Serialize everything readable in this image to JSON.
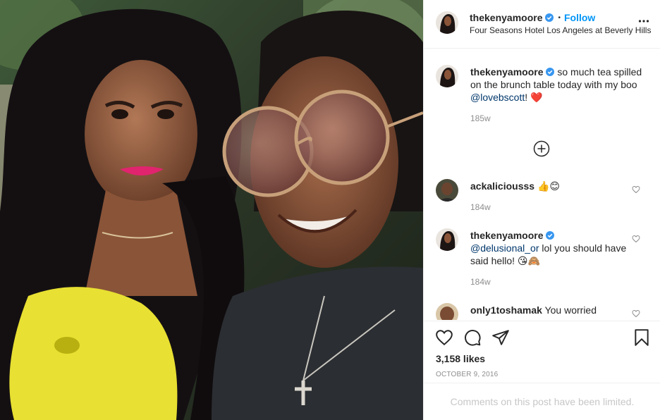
{
  "post": {
    "author": "thekenyamoore",
    "follow_label": "Follow",
    "separator": "•",
    "location": "Four Seasons Hotel Los Angeles at Beverly Hills",
    "likes": "3,158 likes",
    "date": "OCTOBER 9, 2016",
    "comments_limited": "Comments on this post have been limited."
  },
  "caption": {
    "author": "thekenyamoore",
    "text_before": "so much tea spilled on the brunch table today with my boo ",
    "mention": "@lovebscott",
    "text_after": "! ❤️",
    "age": "185w"
  },
  "comments": [
    {
      "author": "ackaliciousss",
      "text": "👍😊",
      "age": "184w"
    },
    {
      "author": "thekenyamoore",
      "mention": "@delusional_or",
      "text": " lol you should have said hello! 😘🙈",
      "age": "184w"
    },
    {
      "author": "only1toshamak",
      "text": "You worried"
    }
  ],
  "icons": {
    "more": "more-options-icon",
    "verified": "verified-badge-icon",
    "load_more": "load-more-plus-icon",
    "like": "heart-icon",
    "comment": "comment-icon",
    "share": "share-icon",
    "save": "bookmark-icon"
  },
  "colors": {
    "accent": "#0095f6",
    "mention": "#00376b",
    "muted": "#8e8e8e",
    "border": "#efefef"
  }
}
